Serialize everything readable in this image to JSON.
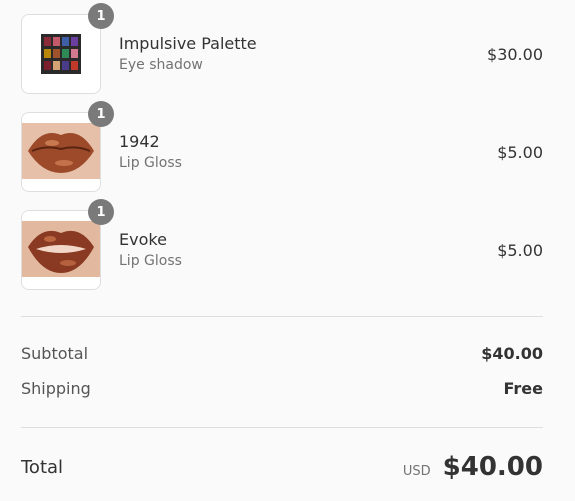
{
  "items": [
    {
      "name": "Impulsive Palette",
      "variant": "Eye shadow",
      "price": "$30.00",
      "qty": "1",
      "image": "eyeshadow-palette"
    },
    {
      "name": "1942",
      "variant": "Lip Gloss",
      "price": "$5.00",
      "qty": "1",
      "image": "lips-bronze"
    },
    {
      "name": "Evoke",
      "variant": "Lip Gloss",
      "price": "$5.00",
      "qty": "1",
      "image": "lips-copper"
    }
  ],
  "summary": {
    "subtotal_label": "Subtotal",
    "subtotal_value": "$40.00",
    "shipping_label": "Shipping",
    "shipping_value": "Free"
  },
  "total": {
    "label": "Total",
    "currency": "USD",
    "amount": "$40.00"
  }
}
